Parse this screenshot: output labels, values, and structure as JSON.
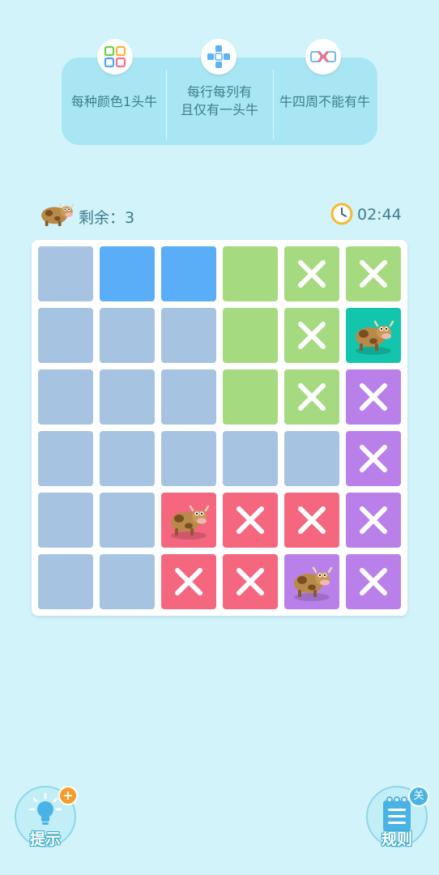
{
  "rules": [
    {
      "icon": "four-colors-icon",
      "text": "每种颜色1头牛"
    },
    {
      "icon": "row-column-icon",
      "text": "每行每列有\n且仅有一头牛"
    },
    {
      "icon": "no-adjacent-icon",
      "text": "牛四周不能有牛"
    }
  ],
  "status": {
    "remaining_label": "剩余：3",
    "timer": "02:44"
  },
  "colors": {
    "A": "#a7c3e2",
    "B": "#5aaef8",
    "C": "#a6da80",
    "D": "#ba80ea",
    "E": "#f4677f",
    "T": "#14c5ad"
  },
  "board": {
    "rows": 6,
    "cols": 6,
    "regions": [
      [
        "A",
        "B",
        "B",
        "C",
        "C",
        "C"
      ],
      [
        "A",
        "A",
        "A",
        "C",
        "C",
        "T"
      ],
      [
        "A",
        "A",
        "A",
        "C",
        "C",
        "D"
      ],
      [
        "A",
        "A",
        "A",
        "A",
        "A",
        "D"
      ],
      [
        "A",
        "A",
        "E",
        "E",
        "E",
        "D"
      ],
      [
        "A",
        "A",
        "E",
        "E",
        "D",
        "D"
      ]
    ],
    "marks": [
      [
        "",
        "",
        "",
        "",
        "x",
        "x"
      ],
      [
        "",
        "",
        "",
        "",
        "x",
        "cow"
      ],
      [
        "",
        "",
        "",
        "",
        "x",
        "x"
      ],
      [
        "",
        "",
        "",
        "",
        "",
        "x"
      ],
      [
        "",
        "",
        "cow",
        "x",
        "x",
        "x"
      ],
      [
        "",
        "",
        "x",
        "x",
        "cow",
        "x"
      ]
    ]
  },
  "buttons": {
    "hint": {
      "label": "提示",
      "badge": "+"
    },
    "rules": {
      "label": "规则",
      "badge": "关"
    }
  }
}
